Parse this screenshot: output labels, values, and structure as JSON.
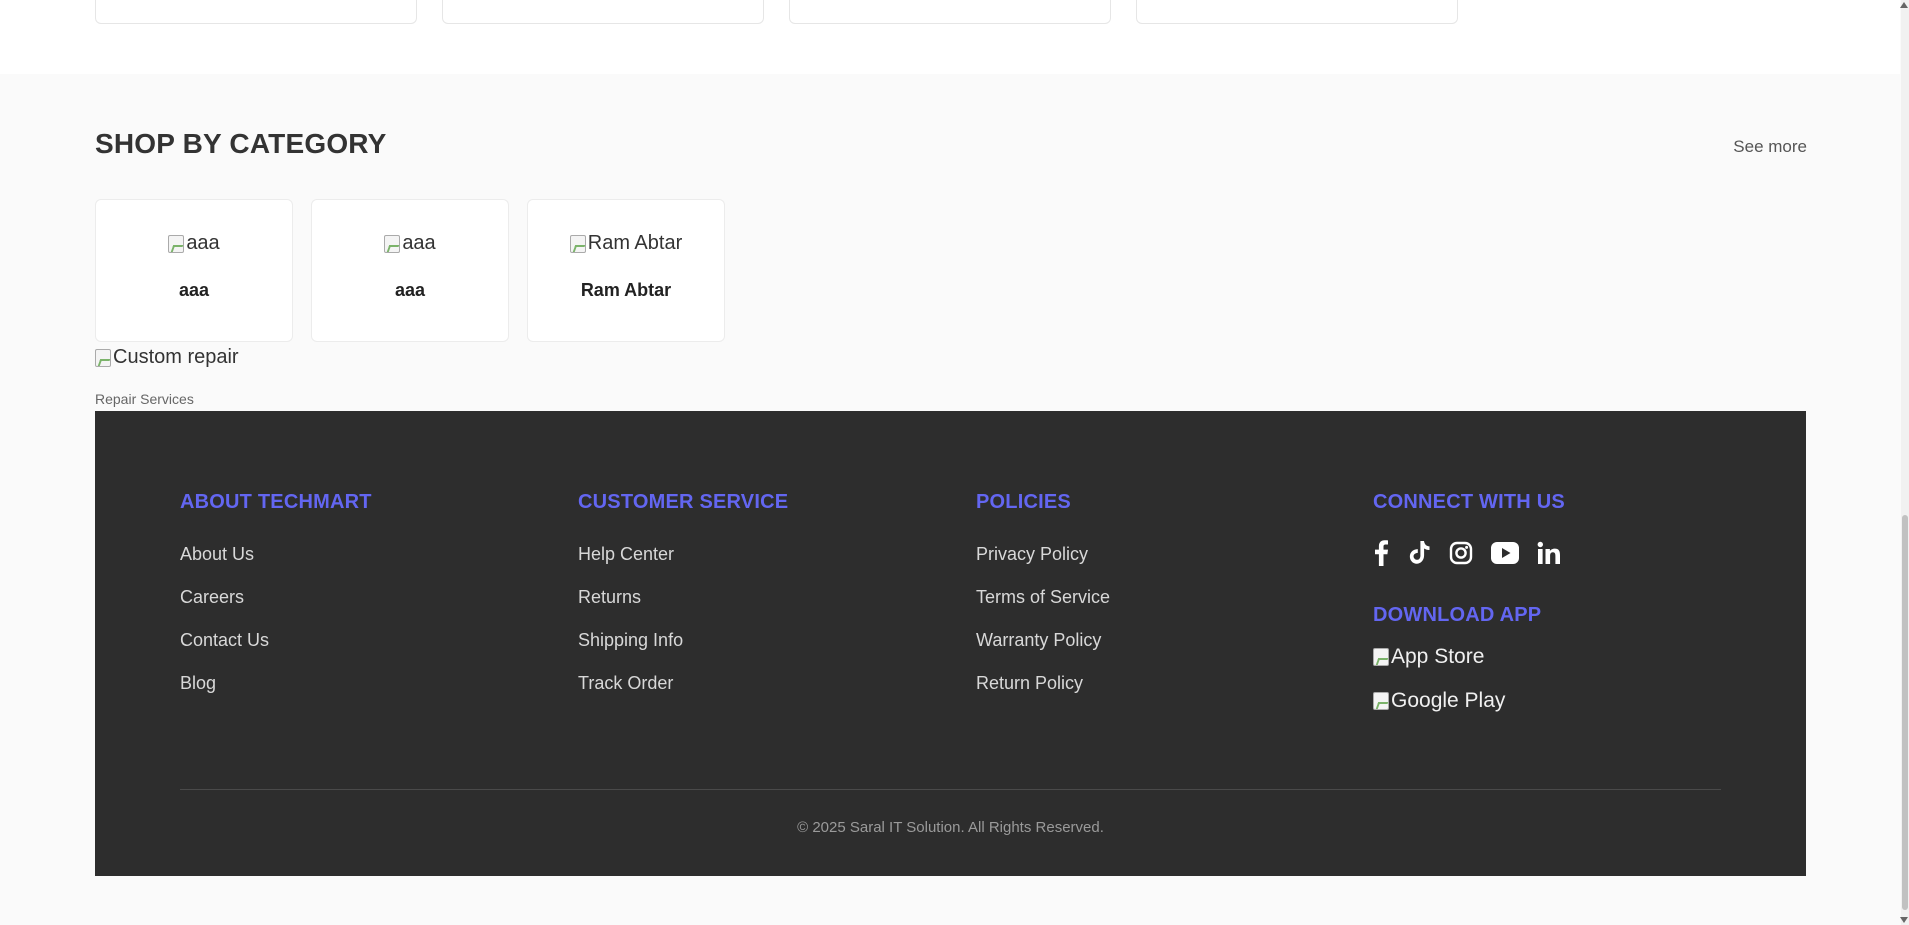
{
  "category_section": {
    "title": "SHOP BY CATEGORY",
    "see_more": "See more",
    "items": [
      {
        "alt": "aaa",
        "name": "aaa"
      },
      {
        "alt": "aaa",
        "name": "aaa"
      },
      {
        "alt": "Ram Abtar",
        "name": "Ram Abtar"
      }
    ]
  },
  "repair": {
    "alt": "Custom repair",
    "label": "Repair Services"
  },
  "footer": {
    "about": {
      "heading": "ABOUT TECHMART",
      "links": [
        "About Us",
        "Careers",
        "Contact Us",
        "Blog"
      ]
    },
    "customer_service": {
      "heading": "CUSTOMER SERVICE",
      "links": [
        "Help Center",
        "Returns",
        "Shipping Info",
        "Track Order"
      ]
    },
    "policies": {
      "heading": "POLICIES",
      "links": [
        "Privacy Policy",
        "Terms of Service",
        "Warranty Policy",
        "Return Policy"
      ]
    },
    "connect": {
      "heading": "CONNECT WITH US",
      "icons": [
        "facebook-icon",
        "tiktok-icon",
        "instagram-icon",
        "youtube-icon",
        "linkedin-icon"
      ]
    },
    "download": {
      "heading": "DOWNLOAD APP",
      "app_store_alt": "App Store",
      "google_play_alt": "Google Play"
    },
    "copyright": "© 2025 Saral IT Solution. All Rights Reserved."
  },
  "colors": {
    "accent": "#6366f1",
    "footer_bg": "#2d2d2d",
    "page_bg": "#fafafa"
  }
}
